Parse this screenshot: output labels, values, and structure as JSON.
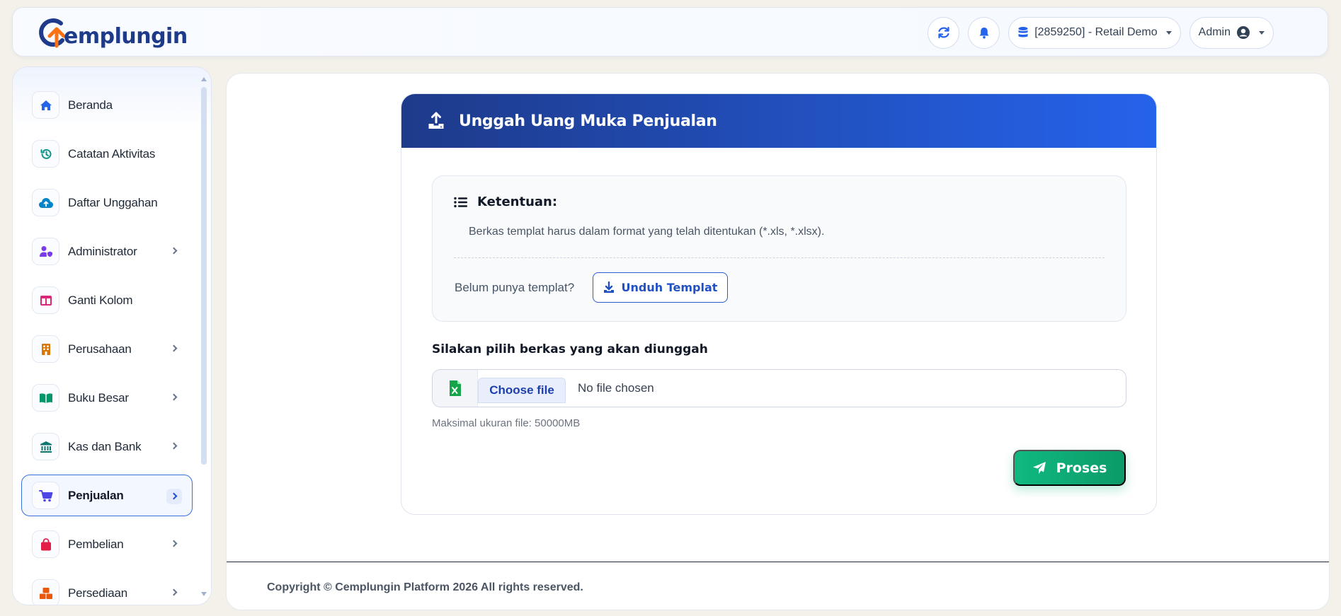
{
  "brand": {
    "name": "emplungin"
  },
  "navbar": {
    "refresh_icon": "refresh-icon",
    "bell_icon": "bell-icon",
    "database": {
      "label": "[2859250] - Retail Demo",
      "icon": "database-icon"
    },
    "user": {
      "label": "Admin",
      "icon": "user-circle-icon"
    }
  },
  "sidebar": {
    "items": [
      {
        "label": "Beranda",
        "icon": "home-icon",
        "color": "#2563eb",
        "has_submenu": false
      },
      {
        "label": "Catatan Aktivitas",
        "icon": "history-icon",
        "color": "#0d9488",
        "has_submenu": false
      },
      {
        "label": "Daftar Unggahan",
        "icon": "cloud-upload-icon",
        "color": "#0284c7",
        "has_submenu": false
      },
      {
        "label": "Administrator",
        "icon": "user-shield-icon",
        "color": "#7c3aed",
        "has_submenu": true
      },
      {
        "label": "Ganti Kolom",
        "icon": "columns-icon",
        "color": "#db2777",
        "has_submenu": false
      },
      {
        "label": "Perusahaan",
        "icon": "building-icon",
        "color": "#d97706",
        "has_submenu": true
      },
      {
        "label": "Buku Besar",
        "icon": "book-open-icon",
        "color": "#059669",
        "has_submenu": true
      },
      {
        "label": "Kas dan Bank",
        "icon": "bank-icon",
        "color": "#0f766e",
        "has_submenu": true
      },
      {
        "label": "Penjualan",
        "icon": "cart-icon",
        "color": "#4f46e5",
        "has_submenu": true,
        "active": true
      },
      {
        "label": "Pembelian",
        "icon": "shopping-bag-icon",
        "color": "#e11d48",
        "has_submenu": true
      },
      {
        "label": "Persediaan",
        "icon": "boxes-icon",
        "color": "#ea580c",
        "has_submenu": true
      }
    ]
  },
  "card": {
    "title": "Unggah Uang Muka Penjualan",
    "rules": {
      "heading": "Ketentuan:",
      "text": "Berkas templat harus dalam format yang telah ditentukan (*.xls, *.xlsx).",
      "template_question": "Belum punya templat?",
      "download_label": "Unduh Templat"
    },
    "file": {
      "label": "Silakan pilih berkas yang akan diunggah",
      "choose_label": "Choose file",
      "status": "No file chosen",
      "max_size": "Maksimal ukuran file: 50000MB"
    },
    "submit_label": "Proses"
  },
  "footer": {
    "copyright": "Copyright © Cemplungin Platform 2026 All rights reserved."
  },
  "colors": {
    "primary": "#1e3a8a",
    "accent": "#2563eb",
    "success": "#10b981",
    "page_bg": "#f4f1ea"
  }
}
